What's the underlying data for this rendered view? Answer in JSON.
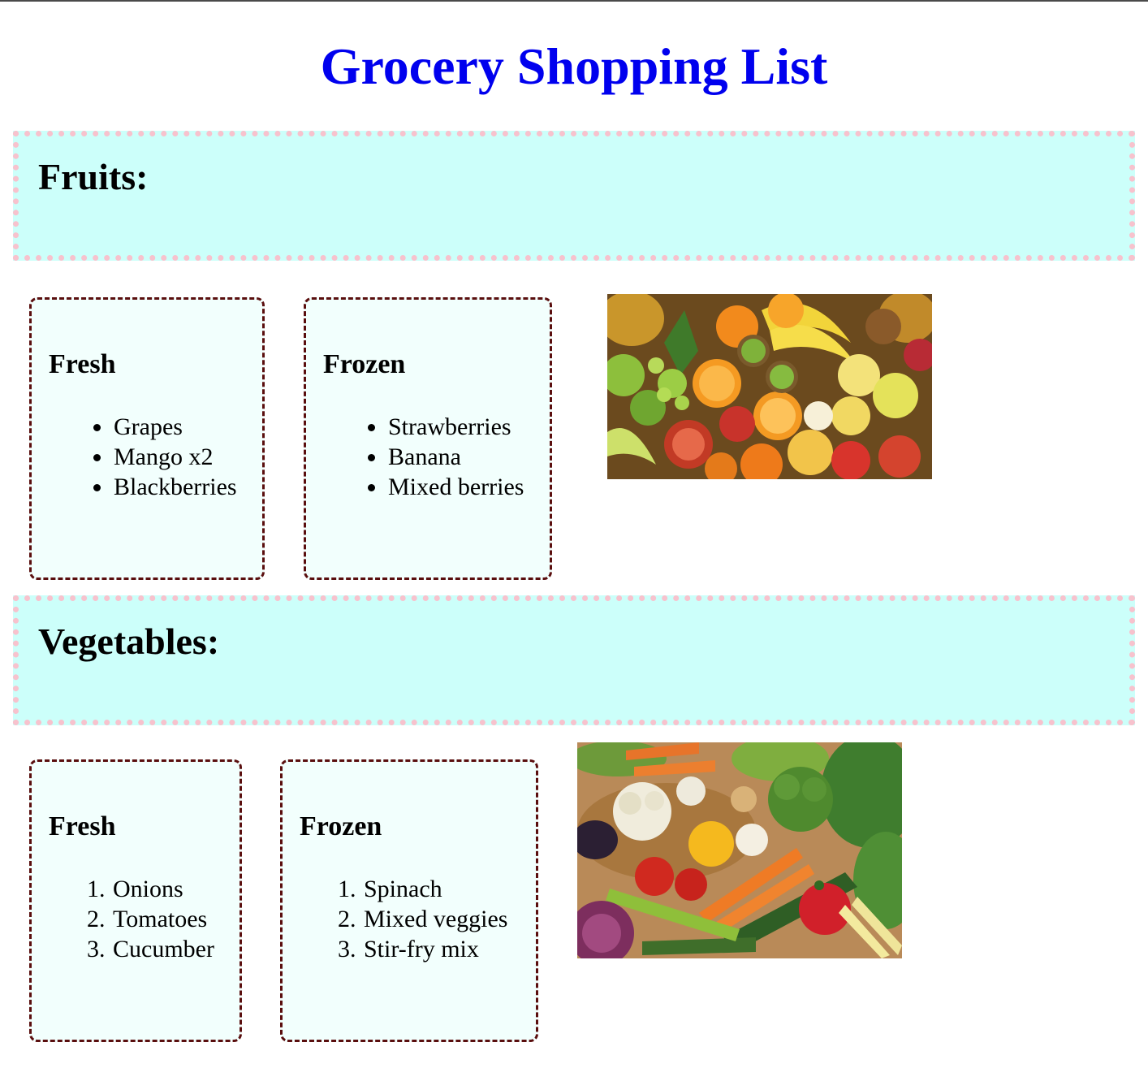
{
  "page": {
    "title": "Grocery Shopping List",
    "title_color": "#0000ee"
  },
  "sections": [
    {
      "heading": "Fruits:",
      "lists": [
        {
          "heading": "Fresh",
          "list_style": "bullet",
          "items": [
            "Grapes",
            "Mango x2",
            "Blackberries"
          ]
        },
        {
          "heading": "Frozen",
          "list_style": "bullet",
          "items": [
            "Strawberries",
            "Banana",
            "Mixed berries"
          ]
        }
      ]
    },
    {
      "heading": "Vegetables:",
      "lists": [
        {
          "heading": "Fresh",
          "list_style": "numbered",
          "markers": [
            "1.",
            "2.",
            "3."
          ],
          "items": [
            "Onions",
            "Tomatoes",
            "Cucumber"
          ]
        },
        {
          "heading": "Frozen",
          "list_style": "numbered",
          "markers": [
            "1.",
            "2.",
            "3."
          ],
          "items": [
            "Spinach",
            "Mixed veggies",
            "Stir-fry mix"
          ]
        }
      ]
    }
  ],
  "colors": {
    "section_background": "#ccfffa",
    "section_border": "#f7c2cd",
    "card_background": "#f2fffd",
    "card_border": "#5a0e0e"
  }
}
